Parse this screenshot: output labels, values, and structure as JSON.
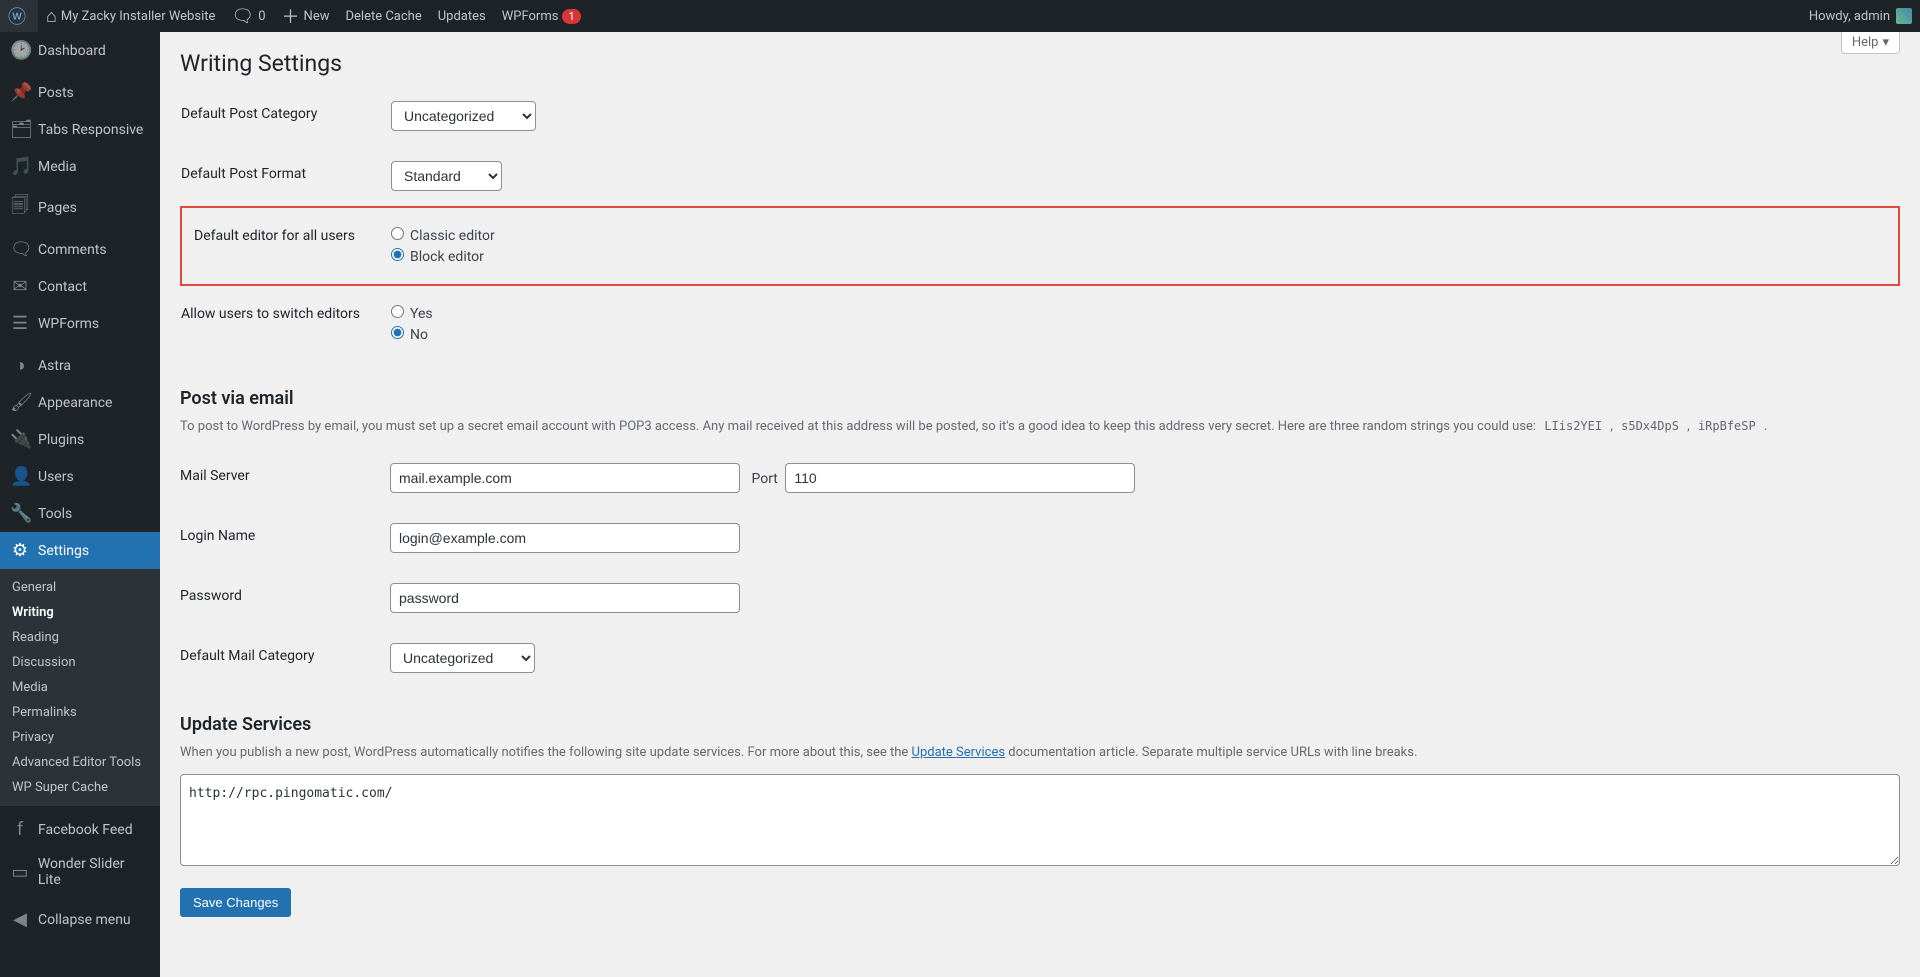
{
  "adminbar": {
    "site_name": "My Zacky Installer Website",
    "comments_count": "0",
    "new_label": "New",
    "delete_cache": "Delete Cache",
    "updates": "Updates",
    "wpforms": "WPForms",
    "wpforms_badge": "1",
    "howdy": "Howdy, admin"
  },
  "sidebar": {
    "items": [
      {
        "label": "Dashboard",
        "icon": "⌂"
      },
      {
        "label": "Posts",
        "icon": "✎"
      },
      {
        "label": "Tabs Responsive",
        "icon": "🗀"
      },
      {
        "label": "Media",
        "icon": "🖾"
      },
      {
        "label": "Pages",
        "icon": "🗋"
      },
      {
        "label": "Comments",
        "icon": "🗨"
      },
      {
        "label": "Contact",
        "icon": "✉"
      },
      {
        "label": "WPForms",
        "icon": "≡"
      },
      {
        "label": "Astra",
        "icon": "◐"
      },
      {
        "label": "Appearance",
        "icon": "🖌"
      },
      {
        "label": "Plugins",
        "icon": "🔌"
      },
      {
        "label": "Users",
        "icon": "👤"
      },
      {
        "label": "Tools",
        "icon": "🔧"
      },
      {
        "label": "Settings",
        "icon": "⚙"
      }
    ],
    "submenu": [
      {
        "label": "General"
      },
      {
        "label": "Writing"
      },
      {
        "label": "Reading"
      },
      {
        "label": "Discussion"
      },
      {
        "label": "Media"
      },
      {
        "label": "Permalinks"
      },
      {
        "label": "Privacy"
      },
      {
        "label": "Advanced Editor Tools"
      },
      {
        "label": "WP Super Cache"
      }
    ],
    "after": [
      {
        "label": "Facebook Feed",
        "icon": "f"
      },
      {
        "label": "Wonder Slider Lite",
        "icon": "▭"
      }
    ],
    "collapse": "Collapse menu"
  },
  "page": {
    "help": "Help",
    "title": "Writing Settings",
    "default_category_label": "Default Post Category",
    "default_category_value": "Uncategorized",
    "default_format_label": "Default Post Format",
    "default_format_value": "Standard",
    "default_editor_label": "Default editor for all users",
    "classic_editor": "Classic editor",
    "block_editor": "Block editor",
    "allow_switch_label": "Allow users to switch editors",
    "yes": "Yes",
    "no": "No",
    "post_via_email_heading": "Post via email",
    "post_via_email_desc_pre": "To post to WordPress by email, you must set up a secret email account with POP3 access. Any mail received at this address will be posted, so it's a good idea to keep this address very secret. Here are three random strings you could use: ",
    "random1": "LIis2YEI",
    "random2": "s5Dx4DpS",
    "random3": "iRpBfeSP",
    "mail_server_label": "Mail Server",
    "mail_server_value": "mail.example.com",
    "port_label": "Port",
    "port_value": "110",
    "login_name_label": "Login Name",
    "login_name_value": "login@example.com",
    "password_label": "Password",
    "password_value": "password",
    "default_mail_category_label": "Default Mail Category",
    "default_mail_category_value": "Uncategorized",
    "update_services_heading": "Update Services",
    "update_services_desc_pre": "When you publish a new post, WordPress automatically notifies the following site update services. For more about this, see the ",
    "update_services_link": "Update Services",
    "update_services_desc_post": " documentation article. Separate multiple service URLs with line breaks.",
    "update_services_value": "http://rpc.pingomatic.com/",
    "save_changes": "Save Changes"
  }
}
